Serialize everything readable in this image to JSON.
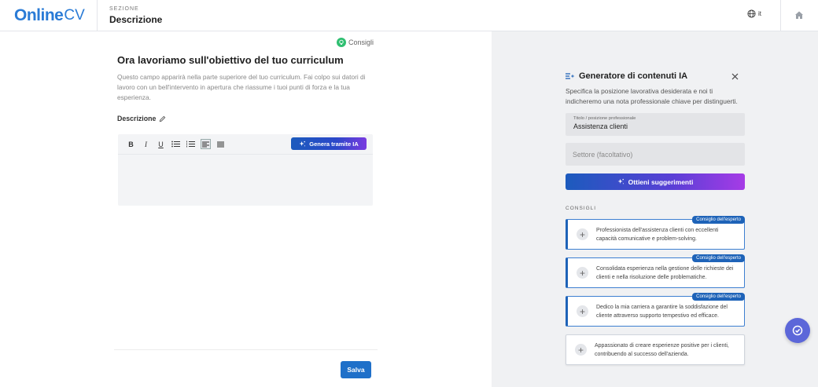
{
  "header": {
    "logo_main": "Online",
    "logo_suffix": "CV",
    "section_label": "SEZIONE",
    "section_title": "Descrizione",
    "language": "it"
  },
  "editor_page": {
    "tips_label": "Consigli",
    "heading": "Ora lavoriamo sull'obiettivo del tuo curriculum",
    "intro": "Questo campo apparirà nella parte superiore del tuo curriculum. Fai colpo sui datori di lavoro con un bell'intervento in apertura che riassume i tuoi punti di forza e la tua esperienza.",
    "description_label": "Descrizione",
    "toolbar": {
      "bold": "B",
      "italic": "I",
      "underline": "U",
      "generate_label": "Genera tramite IA"
    },
    "save_label": "Salva"
  },
  "generator": {
    "title": "Generatore di contenuti IA",
    "description": "Specifica la posizione lavorativa desiderata e noi ti indicheremo una nota professionale chiave per distinguerti.",
    "job_title_label": "Titolo / posizione professionale",
    "job_title_value": "Assistenza clienti",
    "sector_placeholder": "Settore (facoltativo)",
    "suggestions_button": "Ottieni suggerimenti",
    "tips_heading": "CONSIGLI",
    "expert_badge": "Consiglio dell'esperto",
    "suggestions": [
      {
        "text": "Professionista dell'assistenza clienti con eccellenti capacità comunicative e problem-solving.",
        "expert": true
      },
      {
        "text": "Consolidata esperienza nella gestione delle richieste dei clienti e nella risoluzione delle problematiche.",
        "expert": true
      },
      {
        "text": "Dedico la mia carriera a garantire la soddisfazione del cliente attraverso supporto tempestivo ed efficace.",
        "expert": true
      },
      {
        "text": "Appassionato di creare esperienze positive per i clienti, contribuendo al successo dell'azienda.",
        "expert": false
      }
    ]
  },
  "colors": {
    "brand_blue": "#2a7bd6",
    "button_blue": "#1f70c9",
    "badge_blue": "#1e63b8",
    "gradient_purple": "#a63be6",
    "tips_green": "#2fbf71",
    "fab_purple": "#5c67d9"
  },
  "icons": [
    "globe-icon",
    "home-icon",
    "lightbulb-icon",
    "pencil-icon",
    "sparkle-icon",
    "ai-generator-icon",
    "close-icon",
    "plus-icon",
    "chat-support-icon"
  ]
}
